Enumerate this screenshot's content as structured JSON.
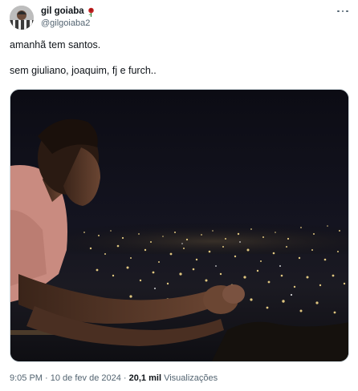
{
  "author": {
    "display_name": "gil goiaba",
    "handle": "@gilgoiaba2",
    "name_emoji_icon": "rose-icon",
    "avatar_icon": "avatar"
  },
  "header": {
    "more_icon": "more-icon"
  },
  "tweet": {
    "line1": "amanhã tem santos.",
    "line2": "sem giuliano, joaquim, fj e furch.."
  },
  "media": {
    "kind": "photo",
    "description_icon": "night-city-photo"
  },
  "meta": {
    "time": "9:05 PM",
    "separator1": "·",
    "date": "10 de fev de 2024",
    "separator2": "·",
    "views_count": "20,1 mil",
    "views_label": "Visualizações"
  },
  "colors": {
    "text": "#0f1419",
    "muted": "#536471",
    "border": "#cfd9de"
  }
}
